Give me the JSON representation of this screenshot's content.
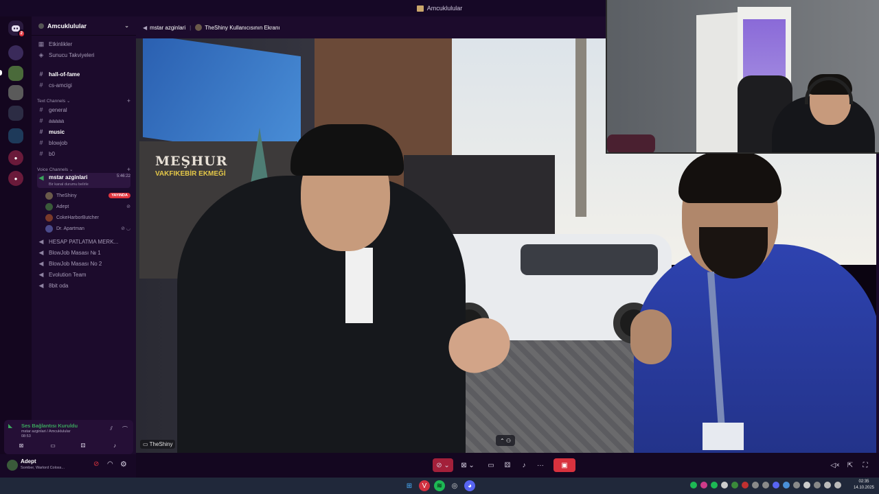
{
  "window": {
    "title": "Amcuklulular"
  },
  "server": {
    "name": "Amcuklulular"
  },
  "nav": {
    "events": "Etkinlikler",
    "boosts": "Sunucu Takviyeleri"
  },
  "pinned_channels": [
    "hall-of-fame",
    "cs-amcigi"
  ],
  "text_category": "Text Channels",
  "text_channels": [
    "general",
    "aaaaa",
    "music",
    "blowjob",
    "b0"
  ],
  "voice_category": "Voice Channels",
  "active_voice": {
    "name": "mstar azginlari",
    "timer": "5:46:22",
    "status": "Bir kanal durumu belirle"
  },
  "voice_members": [
    {
      "name": "TheShiny",
      "badge": "YAYINDA"
    },
    {
      "name": "Adept"
    },
    {
      "name": "CokeHarborButcher"
    },
    {
      "name": "Dr. Apartman"
    }
  ],
  "voice_channels": [
    "HESAP PATLATMA MERK...",
    "BlowJob Masası № 1",
    "BlowJob Masası No 2",
    "Evolution Team",
    "8bit oda"
  ],
  "voice_connection": {
    "status": "Ses Bağlantısı Kuruldu",
    "location": "mstar azginlari / Amcuklulular",
    "elapsed": "08:53"
  },
  "user": {
    "name": "Adept",
    "activity": "Somber, Warlord Coloss..."
  },
  "stream": {
    "channel": "mstar azginlari",
    "title": "TheShiny Kullanıcısının Ekranı",
    "watermark": "TheShiny",
    "sign_main": "MEŞHUR",
    "sign_sub": "VAKFIKEBİR EKMEĞİ"
  },
  "taskbar": {
    "time": "02:35",
    "date": "14.10.2025"
  },
  "colors": {
    "accent": "#e0343e",
    "sidebar": "#1c0b2c",
    "rail": "#14061f",
    "connected": "#3ba55d"
  }
}
